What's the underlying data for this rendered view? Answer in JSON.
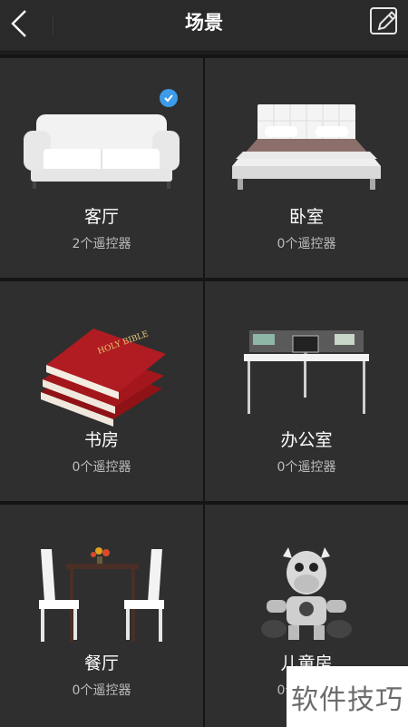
{
  "header": {
    "title": "场景"
  },
  "scenes": [
    {
      "name": "客厅",
      "count": "2个遥控器",
      "icon": "sofa-icon",
      "selected": true
    },
    {
      "name": "卧室",
      "count": "0个遥控器",
      "icon": "bed-icon",
      "selected": false
    },
    {
      "name": "书房",
      "count": "0个遥控器",
      "icon": "book-icon",
      "selected": false
    },
    {
      "name": "办公室",
      "count": "0个遥控器",
      "icon": "desk-icon",
      "selected": false
    },
    {
      "name": "餐厅",
      "count": "0个遥控器",
      "icon": "dining-table-icon",
      "selected": false
    },
    {
      "name": "儿童房",
      "count": "0个遥控器",
      "icon": "toy-robot-icon",
      "selected": false
    }
  ],
  "book_cover_text": "HOLY BIBLE",
  "watermark": "软件技巧",
  "colors": {
    "background": "#1e1e1e",
    "tile": "#2f2f2f",
    "accent": "#3d9be9"
  }
}
